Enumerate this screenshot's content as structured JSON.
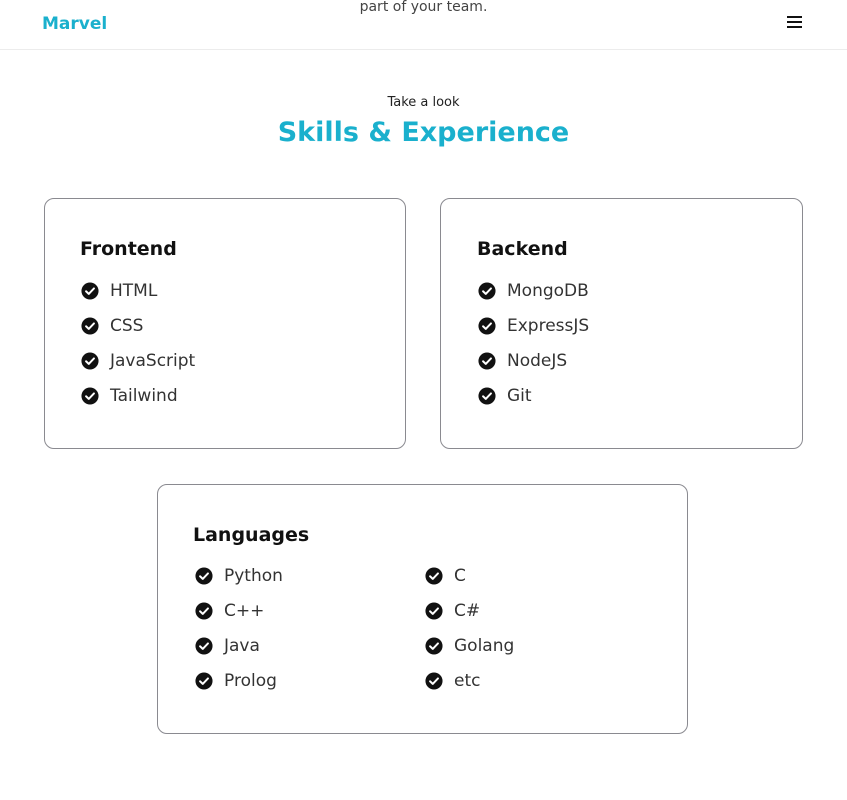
{
  "header": {
    "brand": "Marvel",
    "tagline": "part of your team.",
    "menu_icon": "hamburger-menu-icon"
  },
  "section": {
    "eyebrow": "Take a look",
    "title": "Skills & Experience"
  },
  "accent_color": "#1ab0cd",
  "check_icon": "check-circle-icon",
  "cards": {
    "frontend": {
      "title": "Frontend",
      "skills": [
        "HTML",
        "CSS",
        "JavaScript",
        "Tailwind"
      ]
    },
    "backend": {
      "title": "Backend",
      "skills": [
        "MongoDB",
        "ExpressJS",
        "NodeJS",
        "Git"
      ]
    },
    "languages": {
      "title": "Languages",
      "skills_left": [
        "Python",
        "C++",
        "Java",
        "Prolog"
      ],
      "skills_right": [
        "C",
        "C#",
        "Golang",
        "etc"
      ]
    }
  }
}
